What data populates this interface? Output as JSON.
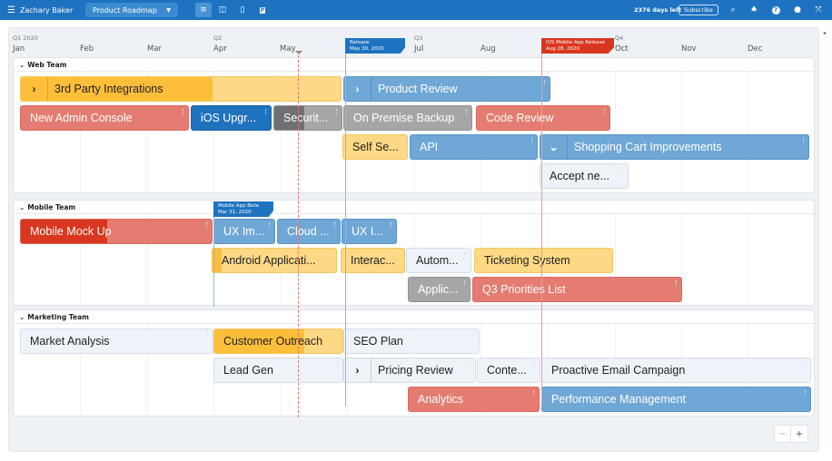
{
  "header": {
    "user_name": "Zachary Baker",
    "roadmap_select": "Product Roadmap",
    "views": [
      {
        "name": "timeline-view",
        "icon": "≡",
        "active": true
      },
      {
        "name": "columns-view",
        "icon": "◫",
        "active": false
      },
      {
        "name": "clipboard-view",
        "icon": "▯",
        "active": false
      },
      {
        "name": "planner-view",
        "icon": "P",
        "active": false
      }
    ],
    "days_left": "2376 days left",
    "subscribe_label": "Subscribe",
    "icons": [
      "search-icon",
      "bell-icon",
      "help-icon",
      "user-icon",
      "fullscreen-icon"
    ]
  },
  "timeline": {
    "quarters": [
      "Q1 2020",
      "Q2",
      "Q3",
      "Q4"
    ],
    "months": [
      "Jan",
      "Feb",
      "Mar",
      "Apr",
      "May",
      "Jul",
      "Aug",
      "Oct",
      "Nov",
      "Dec"
    ]
  },
  "milestones": [
    {
      "title": "Release",
      "date": "May 30, 2020",
      "color": "#1e73c0"
    },
    {
      "title": "iOS Mobile App Release",
      "date": "Aug 28, 2020",
      "color": "#d9371f"
    },
    {
      "title": "Mobile App Beta",
      "date": "Mar 31, 2020",
      "color": "#1e73c0"
    }
  ],
  "groups": [
    {
      "name": "Web Team",
      "bars": [
        {
          "label": "3rd Party Integrations",
          "color": "yellow",
          "expandable": true,
          "progress_percent": 60
        },
        {
          "label": "Product Review",
          "color": "blue",
          "expandable": true
        },
        {
          "label": "New Admin Console",
          "color": "red"
        },
        {
          "label": "iOS Upgr...",
          "color": "darkblue"
        },
        {
          "label": "Securit...",
          "color": "gray",
          "progress_percent": 45
        },
        {
          "label": "On Premise Backup",
          "color": "gray"
        },
        {
          "label": "Code Review",
          "color": "red"
        },
        {
          "label": "Self Se...",
          "color": "yellow"
        },
        {
          "label": "API",
          "color": "blue"
        },
        {
          "label": "Shopping Cart Improvements",
          "color": "blue",
          "expanded": true
        },
        {
          "label": "Accept ne...",
          "color": "light"
        }
      ]
    },
    {
      "name": "Mobile Team",
      "bars": [
        {
          "label": "Mobile Mock Up",
          "color": "red",
          "progress_percent": 45
        },
        {
          "label": "UX Im...",
          "color": "blue"
        },
        {
          "label": "Cloud ...",
          "color": "blue"
        },
        {
          "label": "UX I...",
          "color": "blue"
        },
        {
          "label": "Android Applicati...",
          "color": "yellow",
          "progress_percent": 7
        },
        {
          "label": "Interac...",
          "color": "yellow"
        },
        {
          "label": "Autom...",
          "color": "light"
        },
        {
          "label": "Ticketing System",
          "color": "yellow"
        },
        {
          "label": "Applic...",
          "color": "gray"
        },
        {
          "label": "Q3 Priorities List",
          "color": "red"
        }
      ]
    },
    {
      "name": "Marketing Team",
      "bars": [
        {
          "label": "Market Analysis",
          "color": "light"
        },
        {
          "label": "Customer Outreach",
          "color": "yellow",
          "progress_percent": 70
        },
        {
          "label": "SEO Plan",
          "color": "light"
        },
        {
          "label": "Lead Gen",
          "color": "light"
        },
        {
          "label": "Pricing Review",
          "color": "light",
          "expandable": true
        },
        {
          "label": "Conte...",
          "color": "light"
        },
        {
          "label": "Proactive Email Campaign",
          "color": "light"
        },
        {
          "label": "Analytics",
          "color": "red"
        },
        {
          "label": "Performance Management",
          "color": "blue"
        }
      ]
    }
  ],
  "zoom_controls": {
    "minus": "−",
    "plus": "+"
  }
}
